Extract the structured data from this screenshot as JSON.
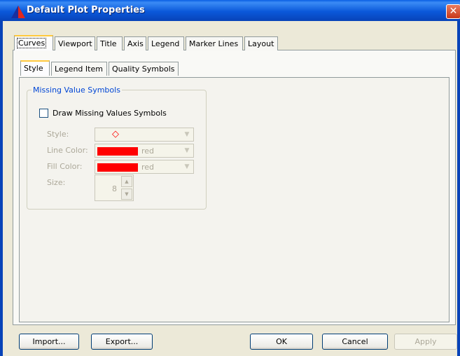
{
  "window": {
    "title": "Default Plot Properties",
    "close_glyph": "✕",
    "app_icon": "triangle-app-icon"
  },
  "tabs": [
    {
      "label": "Curves",
      "active": true
    },
    {
      "label": "Viewport",
      "active": false
    },
    {
      "label": "Title",
      "active": false
    },
    {
      "label": "Axis",
      "active": false
    },
    {
      "label": "Legend",
      "active": false
    },
    {
      "label": "Marker Lines",
      "active": false
    },
    {
      "label": "Layout",
      "active": false
    }
  ],
  "subtabs": [
    {
      "label": "Style",
      "active": true
    },
    {
      "label": "Legend Item",
      "active": false
    },
    {
      "label": "Quality Symbols",
      "active": false
    }
  ],
  "missing_values": {
    "group_title": "Missing Value Symbols",
    "checkbox_label": "Draw Missing Values Symbols",
    "checked": false,
    "style_label": "Style:",
    "style_value": "◇",
    "line_color_label": "Line Color:",
    "line_color": "red",
    "fill_color_label": "Fill Color:",
    "fill_color": "red",
    "size_label": "Size:",
    "size_value": "8",
    "enabled": false
  },
  "buttons": {
    "import": "Import...",
    "export": "Export...",
    "ok": "OK",
    "cancel": "Cancel",
    "apply": "Apply"
  },
  "colors": {
    "title_bar": "#0A58DA",
    "swatch_red": "#FF0000",
    "group_title": "#0046D5",
    "active_tab_accent": "#FFC83C"
  }
}
